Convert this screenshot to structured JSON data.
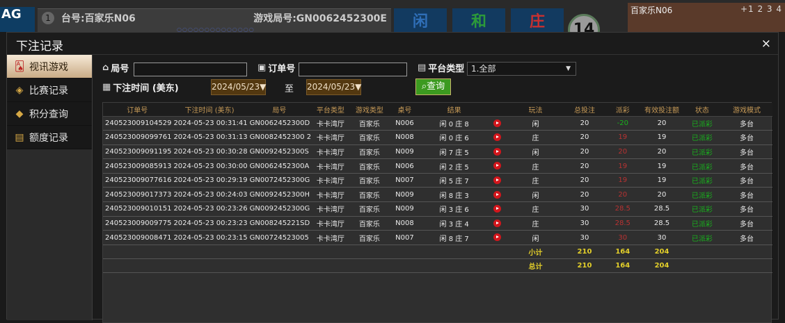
{
  "background": {
    "logo": "AG",
    "round_num": "1",
    "table_name": "台号:百家乐N06",
    "game_round": "游戏局号:GN0062452300E",
    "dots": "○○○○○○○○○○○○○○",
    "bets": [
      "闲",
      "和",
      "庄"
    ],
    "bet_colors": [
      "#2f6fb8",
      "#2c9a3a",
      "#c83030"
    ],
    "count": "14",
    "right_title": "百家乐N06",
    "right_nums": "+1 2 3 4"
  },
  "modal": {
    "title": "下注记录",
    "close": "×"
  },
  "sidebar": {
    "items": [
      {
        "label": "视讯游戏",
        "icon": "🂡",
        "active": true
      },
      {
        "label": "比赛记录",
        "icon": "◈",
        "active": false
      },
      {
        "label": "积分查询",
        "icon": "◆",
        "active": false
      },
      {
        "label": "额度记录",
        "icon": "▤",
        "active": false
      }
    ]
  },
  "filters": {
    "round_label": "局号",
    "order_label": "订单号",
    "platform_label": "平台类型",
    "platform_value": "1.全部",
    "time_label": "下注时间 (美东)",
    "date_from": "2024/05/23▼",
    "to_label": "至",
    "date_to": "2024/05/23▼",
    "query_label": "查询"
  },
  "table": {
    "headers": [
      "订单号",
      "下注时间 (美东)",
      "局号",
      "平台类型",
      "游戏类型",
      "桌号",
      "结果",
      "",
      "玩法",
      "总投注",
      "派彩",
      "有效投注额",
      "状态",
      "游戏模式"
    ],
    "rows": [
      [
        "240523009104529",
        "2024-05-23 00:31:41",
        "GN0062452300D",
        "卡卡湾厅",
        "百家乐",
        "N006",
        "闲 0 庄 8",
        "",
        "闲",
        "20",
        "-20",
        "20",
        "已派彩",
        "多台"
      ],
      [
        "240523009099761",
        "2024-05-23 00:31:13",
        "GN0082452300 2",
        "卡卡湾厅",
        "百家乐",
        "N008",
        "闲 0 庄 6",
        "",
        "庄",
        "20",
        "19",
        "19",
        "已派彩",
        "多台"
      ],
      [
        "240523009091195",
        "2024-05-23 00:30:28",
        "GN0092452300S",
        "卡卡湾厅",
        "百家乐",
        "N009",
        "闲 7 庄 5",
        "",
        "闲",
        "20",
        "20",
        "20",
        "已派彩",
        "多台"
      ],
      [
        "240523009085913",
        "2024-05-23 00:30:00",
        "GN0062452300A",
        "卡卡湾厅",
        "百家乐",
        "N006",
        "闲 2 庄 5",
        "",
        "庄",
        "20",
        "19",
        "19",
        "已派彩",
        "多台"
      ],
      [
        "240523009077616",
        "2024-05-23 00:29:19",
        "GN0072452300G",
        "卡卡湾厅",
        "百家乐",
        "N007",
        "闲 5 庄 7",
        "",
        "庄",
        "20",
        "19",
        "19",
        "已派彩",
        "多台"
      ],
      [
        "240523009017373",
        "2024-05-23 00:24:03",
        "GN0092452300H",
        "卡卡湾厅",
        "百家乐",
        "N009",
        "闲 8 庄 3",
        "",
        "闲",
        "20",
        "20",
        "20",
        "已派彩",
        "多台"
      ],
      [
        "240523009010151",
        "2024-05-23 00:23:26",
        "GN0092452300G",
        "卡卡湾厅",
        "百家乐",
        "N009",
        "闲 3 庄 6",
        "",
        "庄",
        "30",
        "28.5",
        "28.5",
        "已派彩",
        "多台"
      ],
      [
        "240523009009775",
        "2024-05-23 00:23:23",
        "GN008245221SD",
        "卡卡湾厅",
        "百家乐",
        "N008",
        "闲 3 庄 4",
        "",
        "庄",
        "30",
        "28.5",
        "28.5",
        "已派彩",
        "多台"
      ],
      [
        "240523009008471",
        "2024-05-23 00:23:15",
        "GN00724523005",
        "卡卡湾厅",
        "百家乐",
        "N007",
        "闲 8 庄 7",
        "",
        "闲",
        "30",
        "30",
        "30",
        "已派彩",
        "多台"
      ]
    ],
    "subtotal": {
      "label": "小计",
      "total": "210",
      "payout": "164",
      "valid": "204"
    },
    "grandtotal": {
      "label": "总计",
      "total": "210",
      "payout": "164",
      "valid": "204"
    }
  }
}
